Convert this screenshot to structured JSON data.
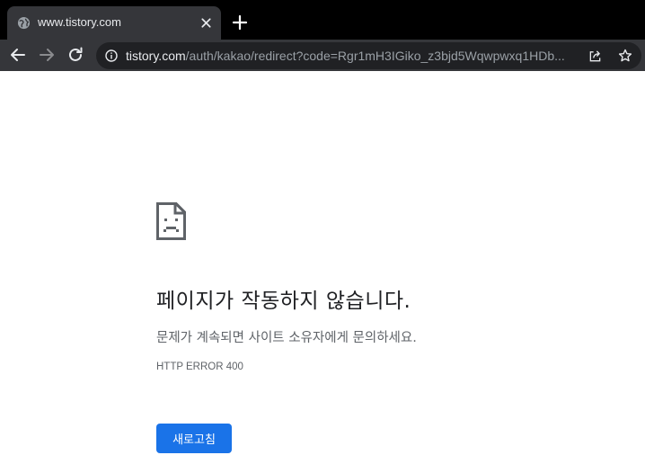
{
  "tab": {
    "title": "www.tistory.com",
    "favicon": "globe-icon",
    "close_icon": "close-icon"
  },
  "new_tab_icon": "plus-icon",
  "toolbar": {
    "back_icon": "arrow-left-icon",
    "forward_icon": "arrow-right-icon",
    "reload_icon": "reload-icon",
    "info_icon": "info-icon",
    "url_host": "tistory.com",
    "url_path": "/auth/kakao/redirect?code=Rgr1mH3IGiko_z3bjd5Wqwpwxq1HDb...",
    "share_icon": "share-icon",
    "bookmark_icon": "star-icon"
  },
  "error_page": {
    "icon": "sad-page-icon",
    "heading": "페이지가 작동하지 않습니다.",
    "message": "문제가 계속되면 사이트 소유자에게 문의하세요.",
    "error_code": "HTTP ERROR 400",
    "reload_label": "새로고침"
  },
  "colors": {
    "tabstrip_bg": "#000000",
    "toolbar_bg": "#35363a",
    "omnibox_bg": "#202124",
    "button_blue": "#1a73e8",
    "heading_text": "#202124",
    "secondary_text": "#5f6368"
  }
}
